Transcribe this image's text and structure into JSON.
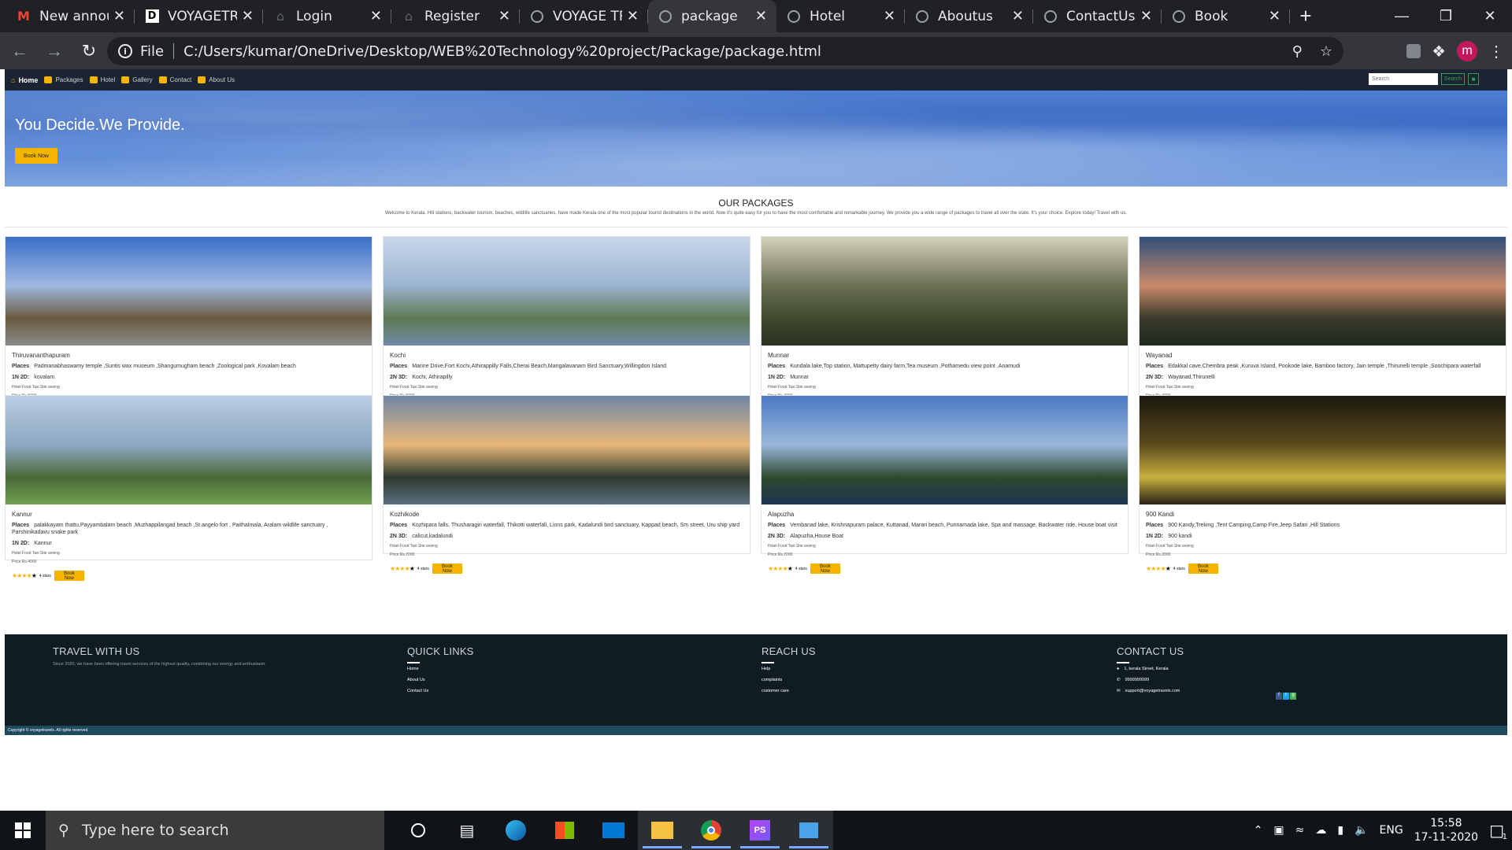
{
  "browser": {
    "tabs": [
      {
        "title": "New announ",
        "favicon": "gmail-icon"
      },
      {
        "title": "VOYAGETRA",
        "favicon": "d-logo-icon"
      },
      {
        "title": "Login",
        "favicon": "home-icon"
      },
      {
        "title": "Register",
        "favicon": "home-icon"
      },
      {
        "title": "VOYAGE TRA",
        "favicon": "globe-icon"
      },
      {
        "title": "package",
        "favicon": "globe-icon",
        "active": true
      },
      {
        "title": "Hotel",
        "favicon": "globe-icon"
      },
      {
        "title": "Aboutus",
        "favicon": "globe-icon"
      },
      {
        "title": "ContactUs",
        "favicon": "globe-icon"
      },
      {
        "title": "Book",
        "favicon": "globe-icon"
      }
    ],
    "url_scheme": "File",
    "url": "C:/Users/kumar/OneDrive/Desktop/WEB%20Technology%20project/Package/package.html",
    "profile_initial": "m"
  },
  "site": {
    "nav": {
      "home": "Home",
      "packages": "Packages",
      "hotel": "Hotel",
      "gallery": "Gallery",
      "contact": "Contact",
      "about": "About Us",
      "search_placeholder": "Search",
      "search_button": "Search"
    },
    "hero": {
      "headline": "You Decide.We Provide.",
      "button": "Book Now"
    },
    "packages": {
      "title": "OUR PACKAGES",
      "intro": "Welcome to Kerala. Hill stations, backwater tourism, beaches, wildlife sanctuaries, have made Kerala one of the most popular tourist destinations in the world. Now it's quite easy for you to have the most comfortable and remarkable journey. We provide you a wide range of packages to travel all over the state. It's your choice. Explore today! Travel with us."
    },
    "labels": {
      "places": "Places",
      "amenities": "Hotel  Food  Taxi  Site seeing",
      "rating": "4 stars",
      "book": "Book Now"
    },
    "cards": [
      {
        "name": "Thiruvananthapuram",
        "places": "Padmanabhaswamy temple ,Suntis wax museum ,Shangumugham beach ,Zoological park ,Kovalam beach",
        "duration": "1N 2D:",
        "stay": "kovalam",
        "price": "Price:Rs.5000",
        "colors": [
          "#3b6fc9",
          "#9fb8e0",
          "#6b5a3e",
          "#8a8a8a"
        ]
      },
      {
        "name": "Kochi",
        "places": "Marine Drive,Fort Kochi,Athirappilly Falls,Cherai Beach,Mangalavanam Bird Sanctuary,Willingdon Island",
        "duration": "2N 3D:",
        "stay": "Kochi, Athirapilly",
        "price": "Price:Rs.5000",
        "colors": [
          "#c9d8ec",
          "#9bb3cf",
          "#5e7a52",
          "#6f8aa8"
        ]
      },
      {
        "name": "Munnar",
        "places": "Kundala lake,Top station, Mattupetty dairy farm,Tea museum ,Pothamedu view point ,Anamudi",
        "duration": "1N 2D:",
        "stay": "Munnar",
        "price": "Price:Rs.4000",
        "colors": [
          "#d3d1ba",
          "#6b6f52",
          "#3e4a2e",
          "#2a3020"
        ]
      },
      {
        "name": "Wayanad",
        "places": "Edakkal cave,Chembra peak ,Kuruva Island, Pookode lake, Bamboo factory, Jain temple ,Thirunelli temple ,Soochipara waterfall",
        "duration": "2N 3D:",
        "stay": "Wayanad,Thirunelli",
        "price": "Price:Rs.4000",
        "colors": [
          "#2f4f7a",
          "#c98a6a",
          "#3a3a2a",
          "#1e2a1e"
        ]
      },
      {
        "name": "Kannur",
        "places": "palakkayam thattu,Payyambalam beach ,Muzhappilangad beach ,St angelo fort , Paithalmala, Aralam wildlife sanctuary , Parshinikadavu snake park",
        "duration": "1N 2D:",
        "stay": "Kannur",
        "price": "Price:Rs.4000",
        "colors": [
          "#b9cde3",
          "#8fa8c3",
          "#4a6a3a",
          "#6fa050"
        ]
      },
      {
        "name": "Kozhikode",
        "places": "Kozhipara falls, Thusharagiri waterfall, Thikotti waterfall, Lions park, Kadalundi bird sanctuary, Kappad beach, Sm street, Uru ship yard",
        "duration": "2N 3D:",
        "stay": "calicut,kadalundi",
        "price": "Price:Rs.7000",
        "colors": [
          "#6f86a8",
          "#e9b87a",
          "#2e3a2e",
          "#5a6e7e"
        ]
      },
      {
        "name": "Alapuzha",
        "places": "Vembanad lake, Krishnapuram palace, Kuttanad, Marari beach, Punnamada lake, Spa and massage, Backwater ride, House boat visit",
        "duration": "2N 3D:",
        "stay": "Alapuzha,House Boat",
        "price": "Price:Rs.7000",
        "colors": [
          "#4a79c0",
          "#9ab8dc",
          "#2e4a2e",
          "#1d3550"
        ]
      },
      {
        "name": "900 Kandi",
        "places": "900 Kandy,Treking ,Tent Camping,Camp Fire,Jeep Safari ,Hill Stations",
        "duration": "1N 2D:",
        "stay": "900 kandi",
        "price": "Price:Rs.2000",
        "colors": [
          "#1a1810",
          "#5a4a1a",
          "#c8b040",
          "#2a2214"
        ]
      }
    ],
    "footer": {
      "col1_title": "TRAVEL WITH US",
      "col1_text": "Since 2020, we have been offering travel services of the highest quality, combining our energy and enthusiasm.",
      "col2_title": "QUICK LINKS",
      "col2_links": [
        "Home",
        "About Us",
        "Contact Us"
      ],
      "col3_title": "REACH US",
      "col3_links": [
        "Help",
        "complaints",
        "customer care"
      ],
      "col4_title": "CONTACT US",
      "address": "1, kerala Street, Kerala",
      "phone": "9999999999",
      "email": "support@voyagetravels.com",
      "copyright": "Copyright © voyagetravels. All rights reserved."
    }
  },
  "taskbar": {
    "search_placeholder": "Type here to search",
    "language": "ENG",
    "time": "15:58",
    "date": "17-11-2020",
    "notifications": "1"
  }
}
